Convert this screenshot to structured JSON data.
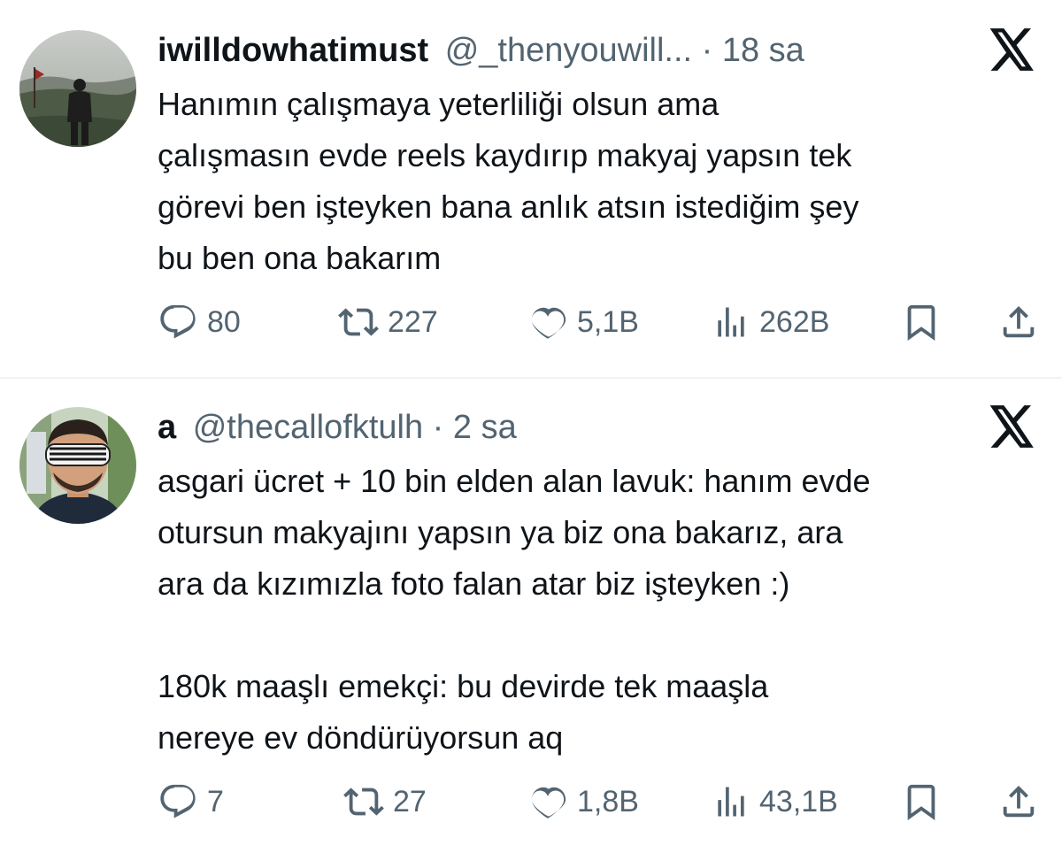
{
  "tweets": [
    {
      "name": "iwilldowhatimust",
      "handle": "@_thenyouwill...",
      "separator": "·",
      "time": "18 sa",
      "body": [
        "Hanımın çalışmaya yeterliliği olsun ama",
        "çalışmasın evde reels kaydırıp makyaj yapsın tek",
        "görevi ben işteyken bana anlık atsın istediğim şey",
        "bu ben ona bakarım"
      ],
      "replies": "80",
      "reposts": "227",
      "likes": "5,1B",
      "views": "262B"
    },
    {
      "name": "a",
      "handle": "@thecallofktulh",
      "separator": "·",
      "time": "2 sa",
      "body": [
        "asgari ücret + 10 bin elden alan lavuk: hanım evde",
        "otursun makyajını yapsın ya biz ona bakarız, ara",
        "ara da kızımızla foto falan atar biz işteyken :)",
        "",
        "180k maaşlı emekçi: bu devirde tek maaşla",
        "nereye ev döndürüyorsun aq"
      ],
      "replies": "7",
      "reposts": "27",
      "likes": "1,8B",
      "views": "43,1B"
    }
  ],
  "icons": {
    "reply": "speech-bubble",
    "repost": "repost-arrows",
    "like": "heart",
    "views": "bar-chart",
    "bookmark": "bookmark",
    "share": "share-upload",
    "brand": "x-logo"
  },
  "colors": {
    "text": "#0f1419",
    "secondary": "#536471",
    "divider": "#eff3f4"
  }
}
